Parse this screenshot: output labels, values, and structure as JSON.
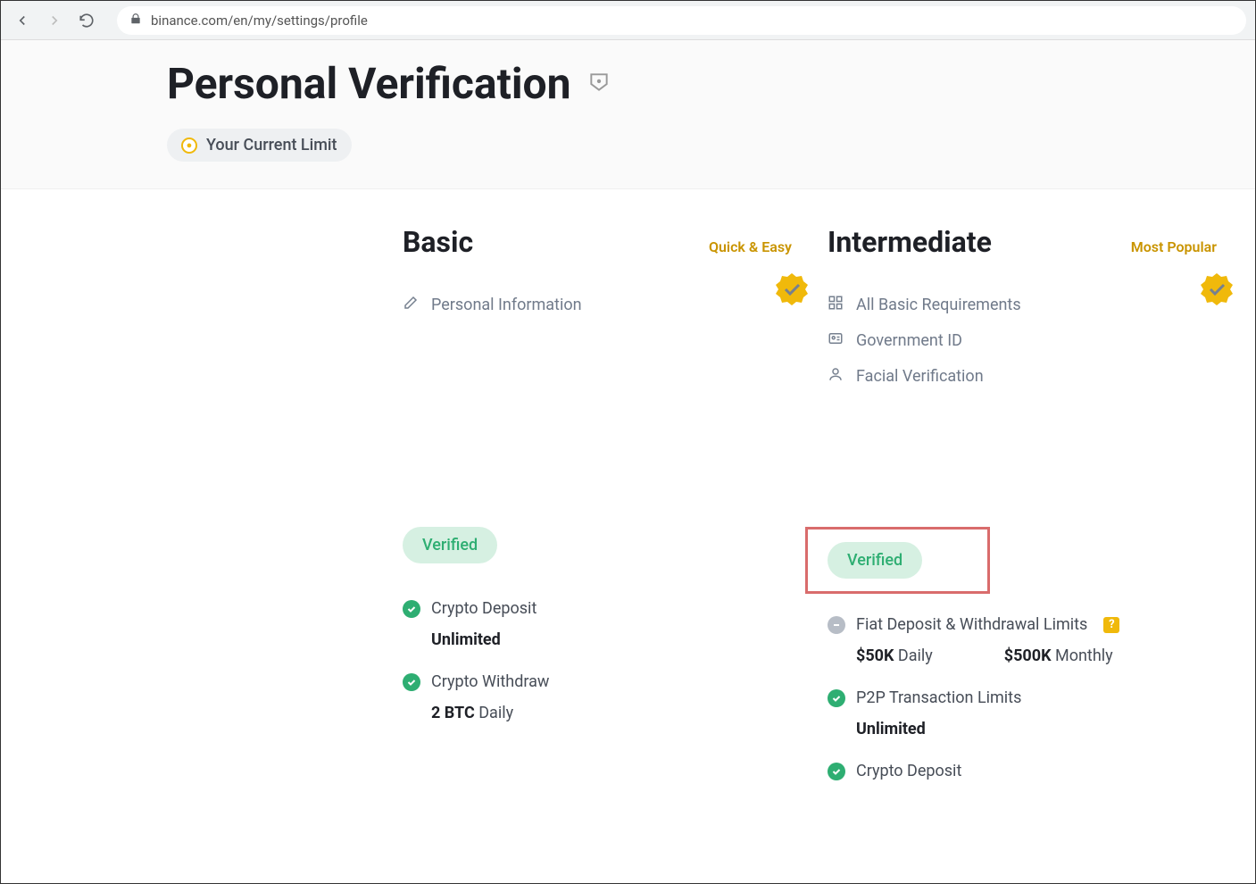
{
  "browser": {
    "url": "binance.com/en/my/settings/profile"
  },
  "header": {
    "title": "Personal Verification",
    "limit_label": "Your Current Limit"
  },
  "tiers": {
    "basic": {
      "title": "Basic",
      "tag": "Quick & Easy",
      "requirements": {
        "r1": "Personal Information"
      },
      "status": "Verified",
      "features": {
        "f1_label": "Crypto Deposit",
        "f1_value_strong": "Unlimited",
        "f2_label": "Crypto Withdraw",
        "f2_value_strong": "2 BTC",
        "f2_value_rest": " Daily"
      }
    },
    "intermediate": {
      "title": "Intermediate",
      "tag": "Most Popular",
      "requirements": {
        "r1": "All Basic Requirements",
        "r2": "Government ID",
        "r3": "Facial Verification"
      },
      "status": "Verified",
      "features": {
        "f1_label": "Fiat Deposit & Withdrawal Limits",
        "f1_help": "?",
        "f1_val1_strong": "$50K",
        "f1_val1_rest": " Daily",
        "f1_val2_strong": "$500K",
        "f1_val2_rest": " Monthly",
        "f2_label": "P2P Transaction Limits",
        "f2_value_strong": "Unlimited",
        "f3_label": "Crypto Deposit"
      }
    }
  }
}
